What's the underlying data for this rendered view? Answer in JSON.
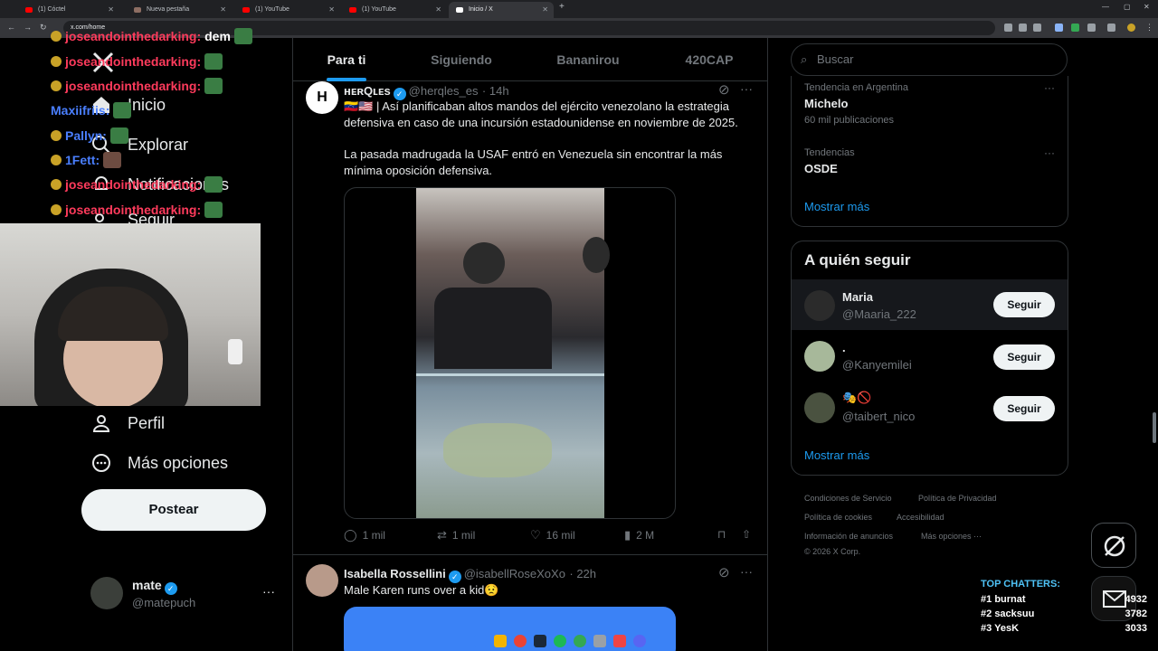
{
  "browser": {
    "tabs": [
      {
        "label": "(1) Cóctel"
      },
      {
        "label": "Nueva pestaña"
      },
      {
        "label": "(1) YouTube"
      },
      {
        "label": "(1) YouTube"
      },
      {
        "label": "Inicio / X"
      }
    ],
    "url": "x.com/home"
  },
  "overlay_chat": [
    {
      "user": "joseandointhedarking:",
      "msg": "dem",
      "color": "#ff3b5c"
    },
    {
      "user": "joseandointhedarking:",
      "msg": "",
      "color": "#ff3b5c"
    },
    {
      "user": "joseandointhedarking:",
      "msg": "",
      "color": "#ff3b5c"
    },
    {
      "user": "Maxiifriis:",
      "msg": "",
      "color": "#4a7fff"
    },
    {
      "user": "Pallyn:",
      "msg": "",
      "color": "#4a7fff"
    },
    {
      "user": "1Fett:",
      "msg": "",
      "color": "#4a7fff"
    },
    {
      "user": "joseandointhedarking:",
      "msg": "",
      "color": "#ff3b5c"
    },
    {
      "user": "joseandointhedarking:",
      "msg": "",
      "color": "#ff3b5c"
    }
  ],
  "nav": {
    "inicio": "Inicio",
    "explorar": "Explorar",
    "notificaciones": "Notificaciones",
    "seguir": "Seguir",
    "perfil": "Perfil",
    "mas": "Más opciones",
    "postear": "Postear"
  },
  "account": {
    "name": "mate",
    "handle": "@matepuch"
  },
  "feed_tabs": [
    "Para ti",
    "Siguiendo",
    "Bananirou",
    "420CAP"
  ],
  "posts": [
    {
      "name": "ʜᴇʀQʟᴇs",
      "handle": "@herqles_es",
      "time": "· 14h",
      "text1": "🇻🇪🇺🇸 | Así planificaban altos mandos del ejército venezolano la estrategia defensiva en caso de una incursión estadounidense en noviembre de 2025.",
      "text2": "La pasada madrugada la USAF entró en Venezuela sin encontrar la más mínima oposición defensiva.",
      "replies": "1 mil",
      "reposts": "1 mil",
      "likes": "16 mil",
      "views": "2 M"
    },
    {
      "name": "Isabella Rossellini",
      "handle": "@isabellRoseXoXo",
      "time": "· 22h",
      "text1": "Male Karen runs over a kid😟"
    }
  ],
  "search": {
    "placeholder": "Buscar"
  },
  "trends": [
    {
      "sub": "Tendencia en Argentina",
      "name": "Michelo",
      "count": "60 mil publicaciones"
    },
    {
      "sub": "Tendencias",
      "name": "OSDE",
      "count": ""
    }
  ],
  "trends_more": "Mostrar más",
  "who_to_follow": {
    "title": "A quién seguir",
    "users": [
      {
        "name": "Maria",
        "handle": "@Maaria_222",
        "button": "Seguir"
      },
      {
        "name": ".",
        "handle": "@Kanyemilei",
        "button": "Seguir"
      },
      {
        "name": "🎭🚫",
        "handle": "@taibert_nico",
        "button": "Seguir"
      }
    ],
    "more": "Mostrar más"
  },
  "footer": {
    "terms": "Condiciones de Servicio",
    "privacy": "Política de Privacidad",
    "cookies": "Política de cookies",
    "access": "Accesibilidad",
    "ads": "Información de anuncios",
    "more": "Más opciones ···",
    "copy": "© 2026 X Corp."
  },
  "top_chatters": {
    "title": "TOP CHATTERS:",
    "rows": [
      {
        "rank": "#1",
        "name": "burnat",
        "count": "4932"
      },
      {
        "rank": "#2",
        "name": "sacksuu",
        "count": "3782"
      },
      {
        "rank": "#3",
        "name": "YesK",
        "count": "3033"
      }
    ]
  },
  "colors": {
    "accent": "#1d9bf0",
    "bg": "#000000",
    "border": "#2f3336"
  }
}
